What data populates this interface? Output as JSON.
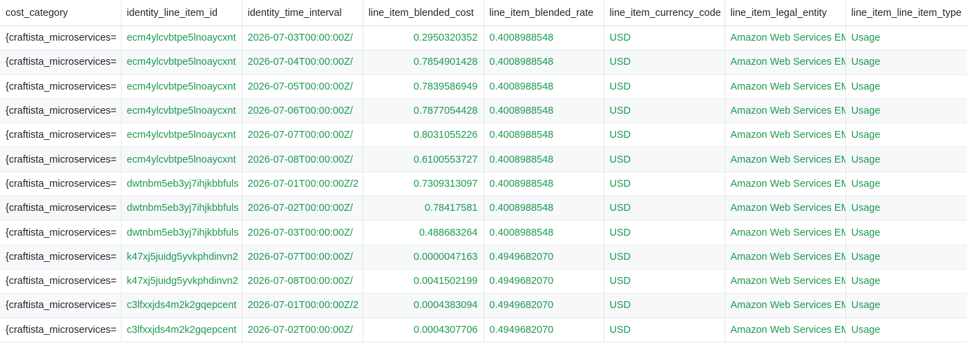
{
  "table": {
    "columns": [
      "cost_category",
      "identity_line_item_id",
      "identity_time_interval",
      "line_item_blended_cost",
      "line_item_blended_rate",
      "line_item_currency_code",
      "line_item_legal_entity",
      "line_item_line_item_type"
    ],
    "rows": [
      [
        "{craftista_microservices=",
        "ecm4ylcvbtpe5lnoaycxnt",
        "2026-07-03T00:00:00Z/",
        "0.2950320352",
        "0.4008988548",
        "USD",
        "Amazon Web Services EM",
        "Usage"
      ],
      [
        "{craftista_microservices=",
        "ecm4ylcvbtpe5lnoaycxnt",
        "2026-07-04T00:00:00Z/",
        "0.7854901428",
        "0.4008988548",
        "USD",
        "Amazon Web Services EM",
        "Usage"
      ],
      [
        "{craftista_microservices=",
        "ecm4ylcvbtpe5lnoaycxnt",
        "2026-07-05T00:00:00Z/",
        "0.7839586949",
        "0.4008988548",
        "USD",
        "Amazon Web Services EM",
        "Usage"
      ],
      [
        "{craftista_microservices=",
        "ecm4ylcvbtpe5lnoaycxnt",
        "2026-07-06T00:00:00Z/",
        "0.7877054428",
        "0.4008988548",
        "USD",
        "Amazon Web Services EM",
        "Usage"
      ],
      [
        "{craftista_microservices=",
        "ecm4ylcvbtpe5lnoaycxnt",
        "2026-07-07T00:00:00Z/",
        "0.8031055226",
        "0.4008988548",
        "USD",
        "Amazon Web Services EM",
        "Usage"
      ],
      [
        "{craftista_microservices=",
        "ecm4ylcvbtpe5lnoaycxnt",
        "2026-07-08T00:00:00Z/",
        "0.6100553727",
        "0.4008988548",
        "USD",
        "Amazon Web Services EM",
        "Usage"
      ],
      [
        "{craftista_microservices=",
        "dwtnbm5eb3yj7ihjkbbfuls",
        "2026-07-01T00:00:00Z/2",
        "0.7309313097",
        "0.4008988548",
        "USD",
        "Amazon Web Services EM",
        "Usage"
      ],
      [
        "{craftista_microservices=",
        "dwtnbm5eb3yj7ihjkbbfuls",
        "2026-07-02T00:00:00Z/",
        "0.78417581",
        "0.4008988548",
        "USD",
        "Amazon Web Services EM",
        "Usage"
      ],
      [
        "{craftista_microservices=",
        "dwtnbm5eb3yj7ihjkbbfuls",
        "2026-07-03T00:00:00Z/",
        "0.488683264",
        "0.4008988548",
        "USD",
        "Amazon Web Services EM",
        "Usage"
      ],
      [
        "{craftista_microservices=",
        "k47xj5juidg5yvkphdinvn2",
        "2026-07-07T00:00:00Z/",
        "0.0000047163",
        "0.4949682070",
        "USD",
        "Amazon Web Services EM",
        "Usage"
      ],
      [
        "{craftista_microservices=",
        "k47xj5juidg5yvkphdinvn2",
        "2026-07-08T00:00:00Z/",
        "0.0041502199",
        "0.4949682070",
        "USD",
        "Amazon Web Services EM",
        "Usage"
      ],
      [
        "{craftista_microservices=",
        "c3lfxxjds4m2k2gqepcent",
        "2026-07-01T00:00:00Z/2",
        "0.0004383094",
        "0.4949682070",
        "USD",
        "Amazon Web Services EM",
        "Usage"
      ],
      [
        "{craftista_microservices=",
        "c3lfxxjds4m2k2gqepcent",
        "2026-07-02T00:00:00Z/",
        "0.0004307706",
        "0.4949682070",
        "USD",
        "Amazon Web Services EM",
        "Usage"
      ]
    ]
  },
  "colors": {
    "value_text": "#1a9a4f",
    "header_text": "#1f2328",
    "stripe": "#f6f8fa"
  }
}
